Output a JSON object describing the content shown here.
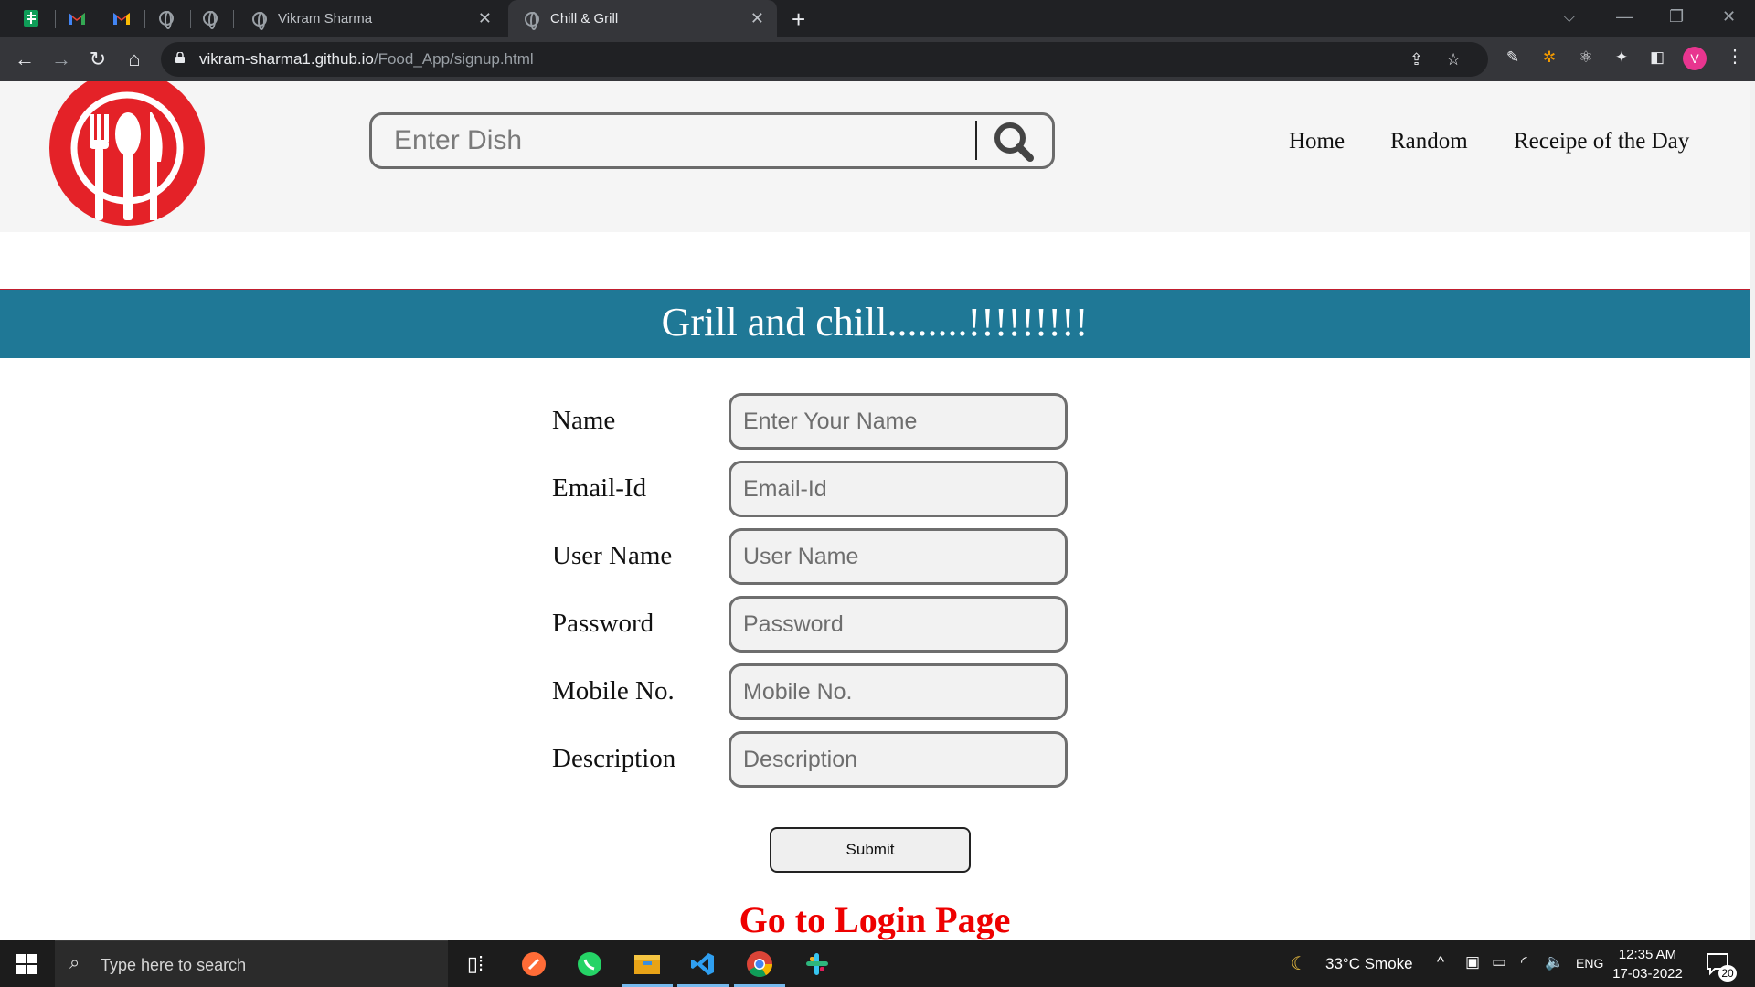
{
  "browser": {
    "tabs": [
      {
        "title": "Vikram Sharma",
        "close": "✕"
      },
      {
        "title": "Chill & Grill",
        "close": "✕"
      }
    ],
    "new_tab": "+",
    "url_domain": "vikram-sharma1.github.io",
    "url_path": "/Food_App/signup.html",
    "profile_initial": "V"
  },
  "header": {
    "search_placeholder": "Enter Dish",
    "nav": [
      "Home",
      "Random",
      "Receipe of the Day"
    ]
  },
  "banner": {
    "text": "Grill and chill........!!!!!!!!!"
  },
  "form": {
    "fields": [
      {
        "label": "Name",
        "placeholder": "Enter Your Name"
      },
      {
        "label": "Email-Id",
        "placeholder": "Email-Id"
      },
      {
        "label": "User Name",
        "placeholder": "User Name"
      },
      {
        "label": "Password",
        "placeholder": "Password"
      },
      {
        "label": "Mobile No.",
        "placeholder": "Mobile No."
      },
      {
        "label": "Description",
        "placeholder": "Description"
      }
    ],
    "submit_label": "Submit",
    "login_link": "Go to Login Page"
  },
  "taskbar": {
    "search_placeholder": "Type here to search",
    "weather": "33°C  Smoke",
    "language": "ENG",
    "time": "12:35 AM",
    "date": "17-03-2022",
    "notification_count": "20"
  },
  "colors": {
    "banner": "#1f7896",
    "logo": "#e42228",
    "login_link": "#ee0000"
  }
}
